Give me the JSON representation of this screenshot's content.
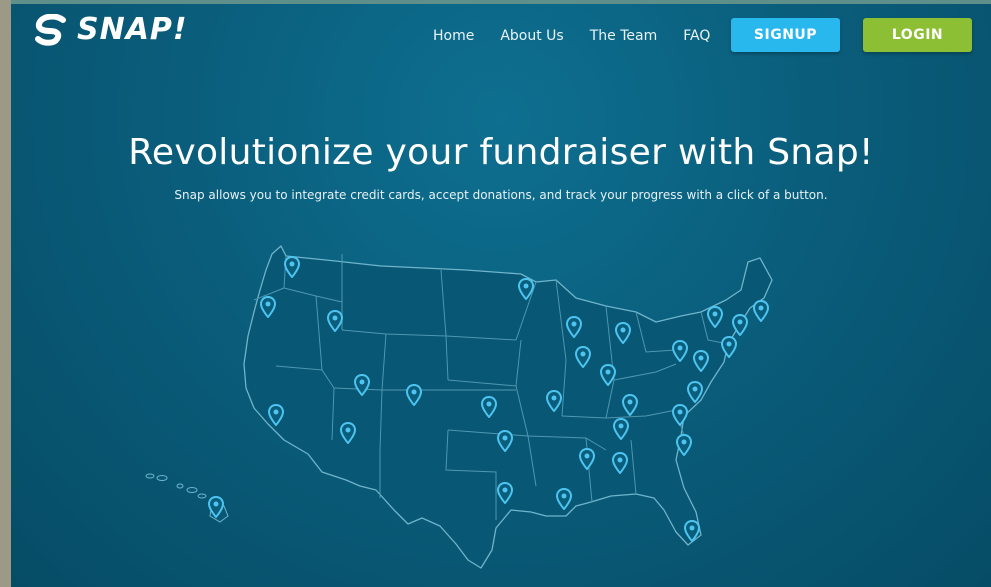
{
  "brand": {
    "name": "SNAP!",
    "colors": {
      "background": "#0a5e7c",
      "signup": "#29b8ee",
      "login": "#8cbf33",
      "pin": "#4ec4f0"
    }
  },
  "nav": {
    "items": [
      "Home",
      "About Us",
      "The Team",
      "FAQ"
    ]
  },
  "actions": {
    "signup_label": "SIGNUP",
    "login_label": "LOGIN"
  },
  "hero": {
    "title": "Revolutionize your fundraiser with Snap!",
    "subtitle": "Snap allows you to integrate credit cards, accept donations, and track your progress with a click of a button."
  },
  "map": {
    "icon": "us-map-with-location-pins"
  }
}
